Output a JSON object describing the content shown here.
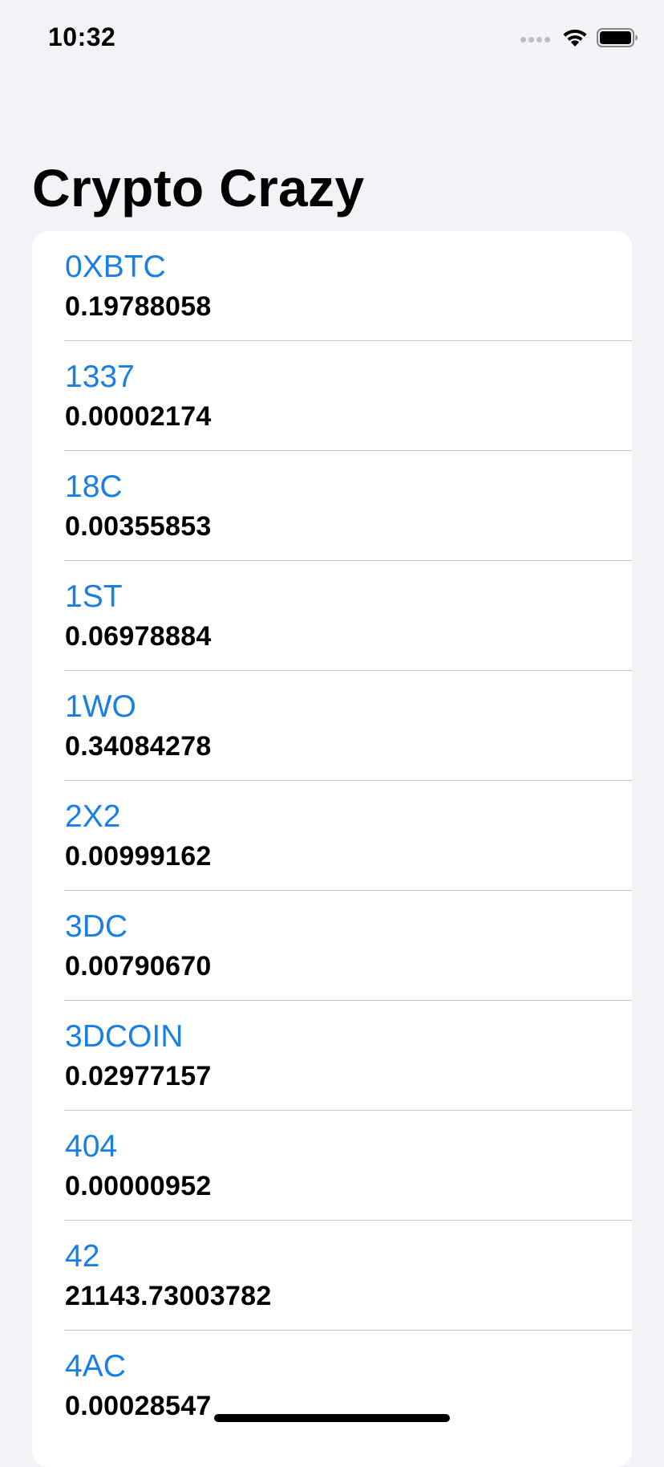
{
  "status_bar": {
    "time": "10:32"
  },
  "header": {
    "title": "Crypto Crazy"
  },
  "coins": [
    {
      "symbol": "0XBTC",
      "price": "0.19788058"
    },
    {
      "symbol": "1337",
      "price": "0.00002174"
    },
    {
      "symbol": "18C",
      "price": "0.00355853"
    },
    {
      "symbol": "1ST",
      "price": "0.06978884"
    },
    {
      "symbol": "1WO",
      "price": "0.34084278"
    },
    {
      "symbol": "2X2",
      "price": "0.00999162"
    },
    {
      "symbol": "3DC",
      "price": "0.00790670"
    },
    {
      "symbol": "3DCOIN",
      "price": "0.02977157"
    },
    {
      "symbol": "404",
      "price": "0.00000952"
    },
    {
      "symbol": "42",
      "price": "21143.73003782"
    },
    {
      "symbol": "4AC",
      "price": "0.00028547"
    }
  ],
  "icons": {
    "signal": "cellular-signal-icon",
    "wifi": "wifi-icon",
    "battery": "battery-icon"
  },
  "colors": {
    "background": "#F2F2F7",
    "accent": "#1A7FE4",
    "card": "#FFFFFF"
  }
}
